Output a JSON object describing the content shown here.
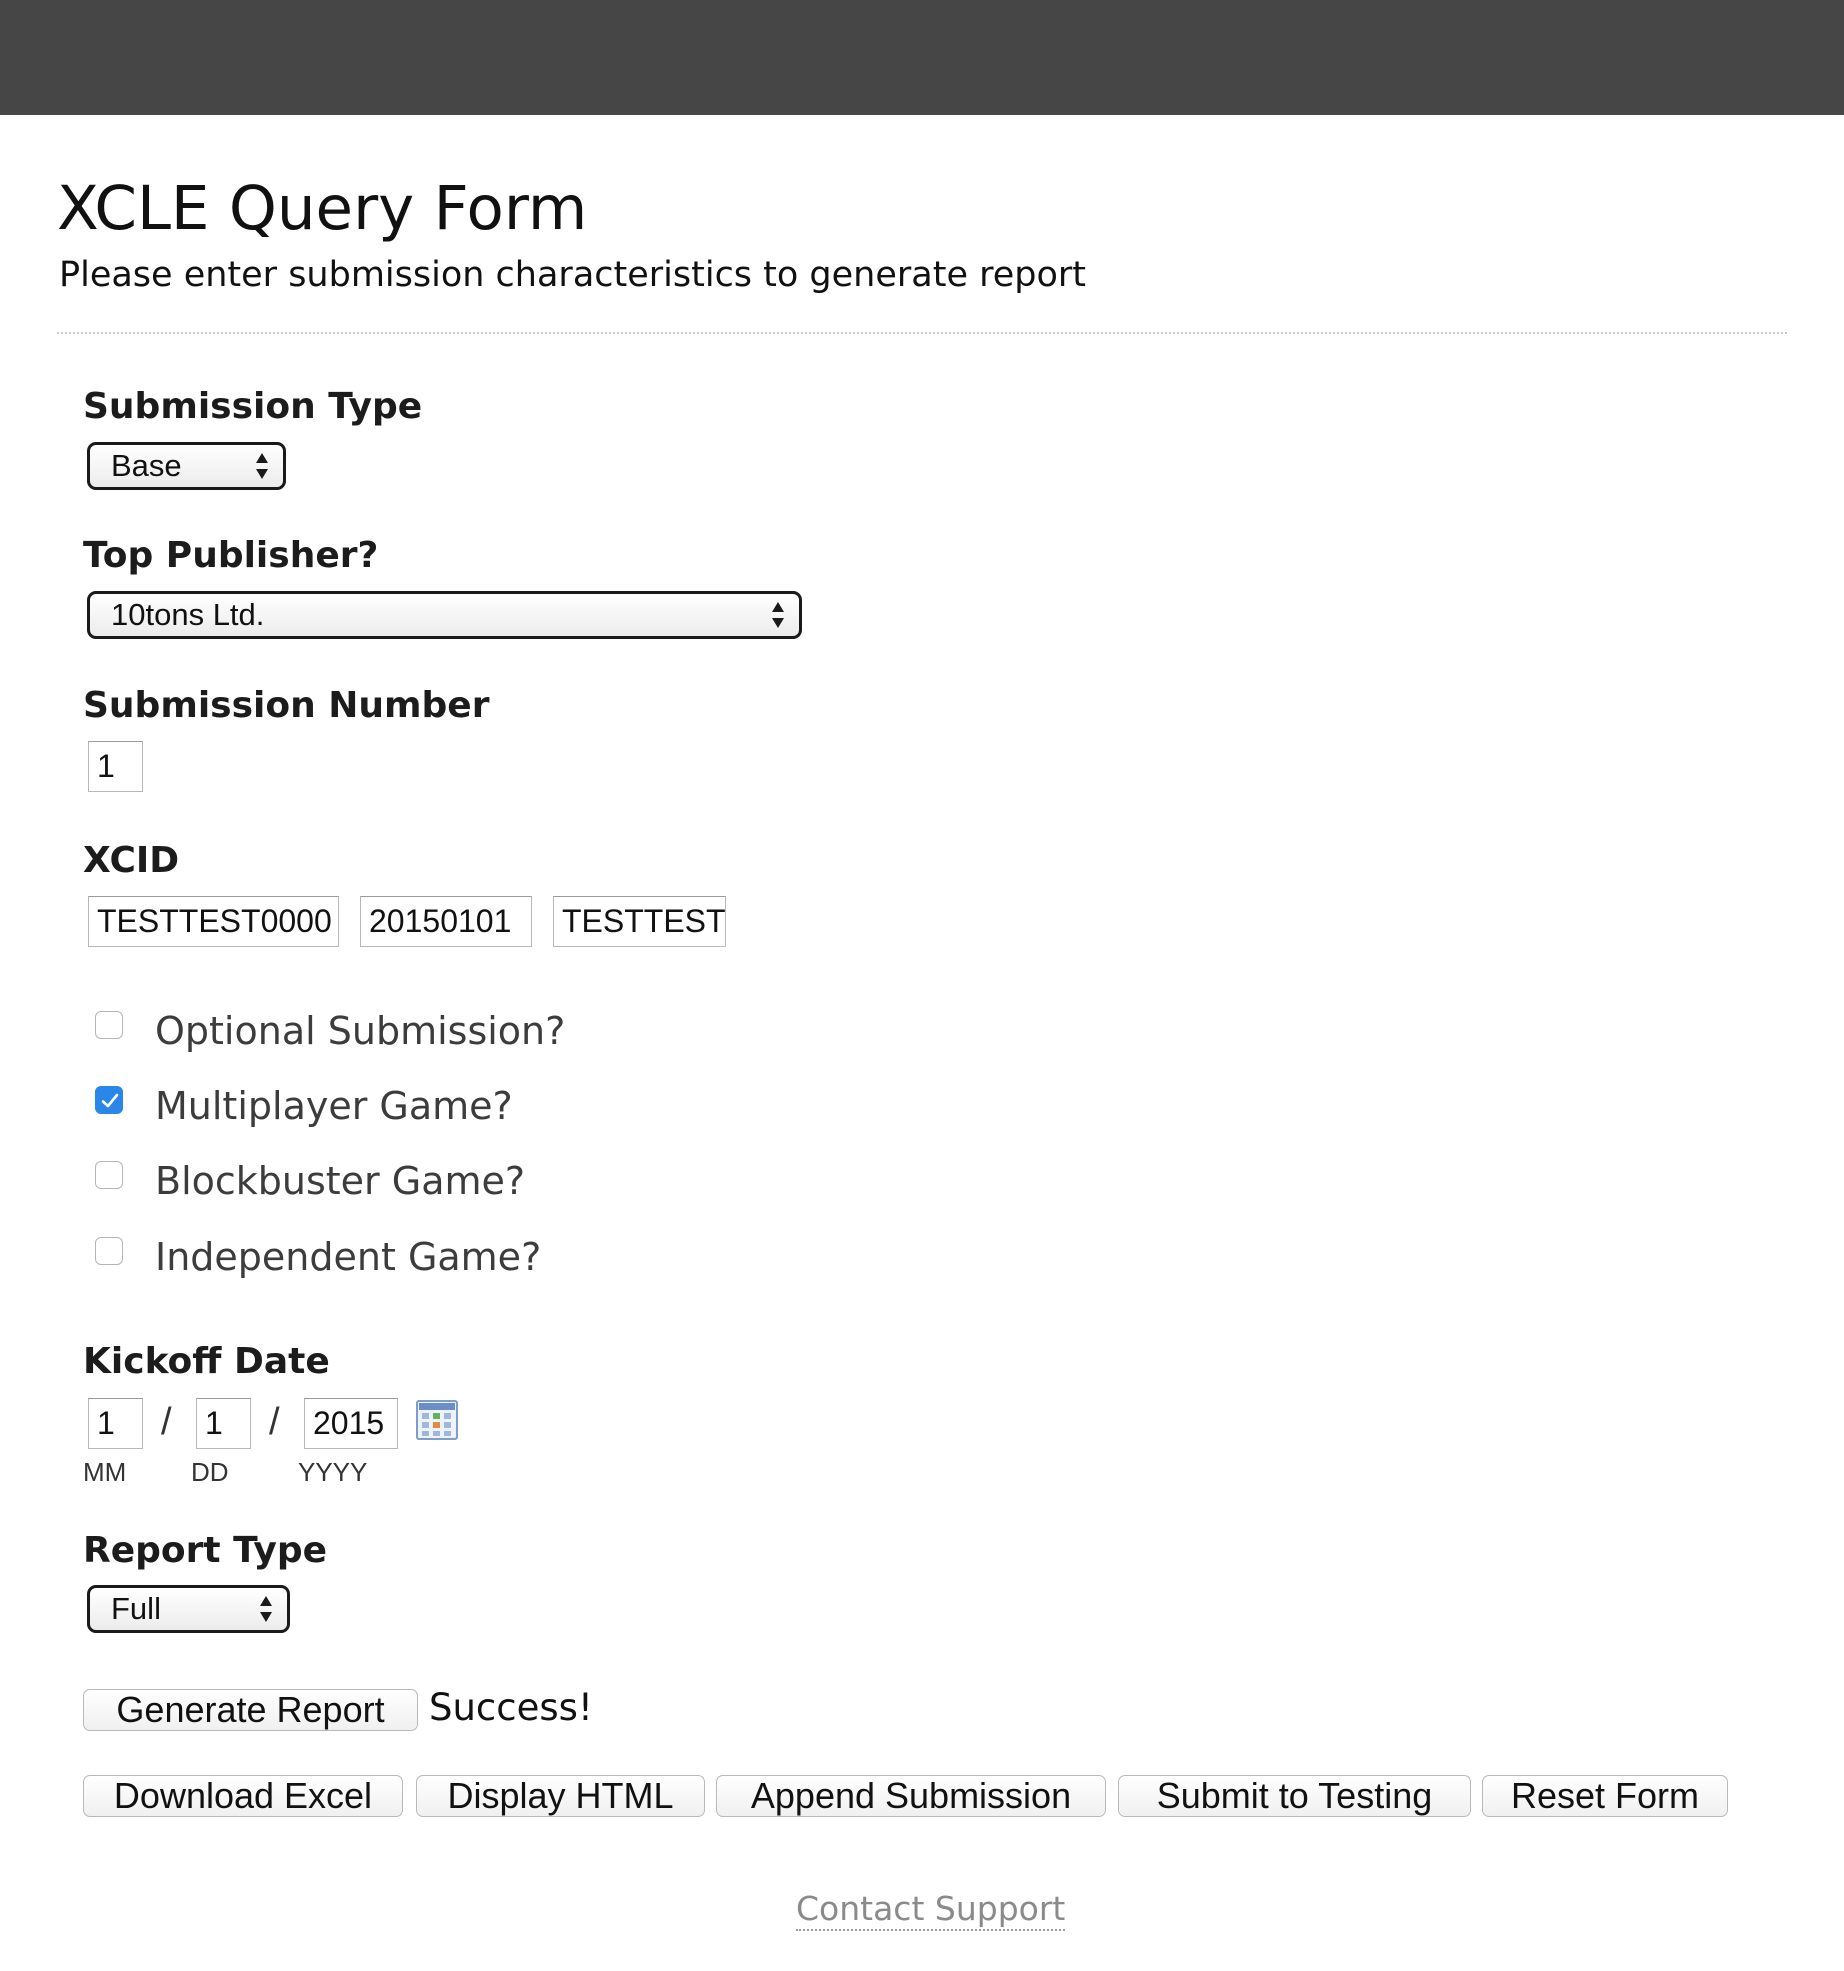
{
  "page": {
    "title": "XCLE Query Form",
    "subtitle": "Please enter submission characteristics to generate report"
  },
  "form": {
    "submission_type": {
      "label": "Submission Type",
      "value": "Base"
    },
    "top_publisher": {
      "label": "Top Publisher?",
      "value": "10tons Ltd."
    },
    "submission_number": {
      "label": "Submission Number",
      "value": "1"
    },
    "xcid": {
      "label": "XCID",
      "part1": "TESTTEST0000",
      "part2": "20150101",
      "part3": "TESTTEST"
    },
    "checkboxes": [
      {
        "label": "Optional Submission?",
        "checked": false
      },
      {
        "label": "Multiplayer Game?",
        "checked": true
      },
      {
        "label": "Blockbuster Game?",
        "checked": false
      },
      {
        "label": "Independent Game?",
        "checked": false
      }
    ],
    "kickoff_date": {
      "label": "Kickoff Date",
      "month": "1",
      "day": "1",
      "year": "2015",
      "separator": "/",
      "month_caption": "MM",
      "day_caption": "DD",
      "year_caption": "YYYY"
    },
    "report_type": {
      "label": "Report Type",
      "value": "Full"
    }
  },
  "actions": {
    "generate_label": "Generate Report",
    "status": "Success!",
    "download_excel_label": "Download Excel",
    "display_html_label": "Display HTML",
    "append_submission_label": "Append Submission",
    "submit_testing_label": "Submit to Testing",
    "reset_form_label": "Reset Form"
  },
  "footer": {
    "contact_label": "Contact Support"
  },
  "colors": {
    "top_bar": "#464646",
    "checkbox_checked": "#2a86e8",
    "footer_link": "#8a8a8a"
  }
}
